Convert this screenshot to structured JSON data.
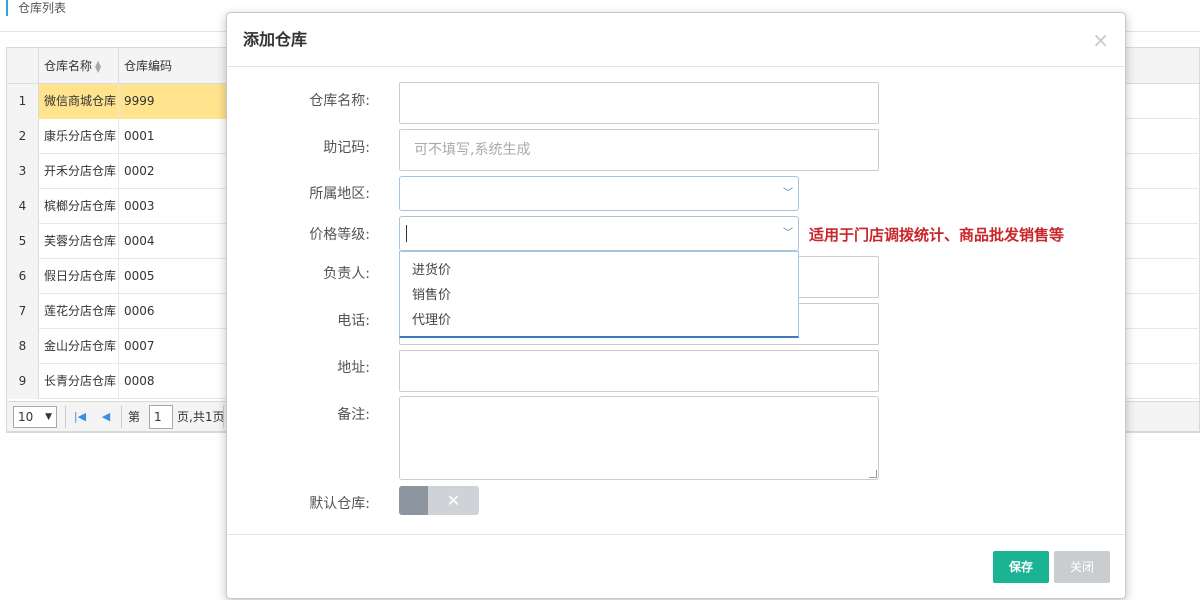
{
  "page": {
    "title": "仓库列表"
  },
  "grid": {
    "headers": {
      "name": "仓库名称",
      "code": "仓库编码"
    },
    "rows": [
      {
        "rn": "1",
        "name": "微信商城仓库",
        "code": "9999"
      },
      {
        "rn": "2",
        "name": "康乐分店仓库",
        "code": "0001"
      },
      {
        "rn": "3",
        "name": "开禾分店仓库",
        "code": "0002"
      },
      {
        "rn": "4",
        "name": "槟榔分店仓库",
        "code": "0003"
      },
      {
        "rn": "5",
        "name": "芙蓉分店仓库",
        "code": "0004"
      },
      {
        "rn": "6",
        "name": "假日分店仓库",
        "code": "0005"
      },
      {
        "rn": "7",
        "name": "莲花分店仓库",
        "code": "0006"
      },
      {
        "rn": "8",
        "name": "金山分店仓库",
        "code": "0007"
      },
      {
        "rn": "9",
        "name": "长青分店仓库",
        "code": "0008"
      }
    ],
    "selected_row": "1"
  },
  "pager": {
    "page_size": "10",
    "page_prefix": "第",
    "page_number": "1",
    "page_suffix": "页,共1页"
  },
  "modal": {
    "title": "添加仓库",
    "close_glyph": "×",
    "fields": {
      "name_label": "仓库名称:",
      "mnemonic_label": "助记码:",
      "mnemonic_placeholder": "可不填写,系统生成",
      "region_label": "所属地区:",
      "price_level_label": "价格等级:",
      "manager_label": "负责人:",
      "phone_label": "电话:",
      "address_label": "地址:",
      "remark_label": "备注:",
      "default_label": "默认仓库:"
    },
    "price_level_options": [
      "进货价",
      "销售价",
      "代理价"
    ],
    "price_level_hint": "适用于门店调拨统计、商品批发销售等",
    "default_toggle": false,
    "save_label": "保存",
    "close_label": "关闭"
  },
  "colors": {
    "selected_row": "#ffe48d",
    "save_button": "#1ab394",
    "close_button": "#cacdd0",
    "hint_text": "#c9262a",
    "title_accent": "#2aa5d9"
  },
  "icons": {
    "sort": "sort-icon",
    "first_page": "first-page-icon",
    "prev_page": "prev-page-icon",
    "select_arrow": "chevron-down-icon",
    "toggle_off": "x-icon"
  }
}
